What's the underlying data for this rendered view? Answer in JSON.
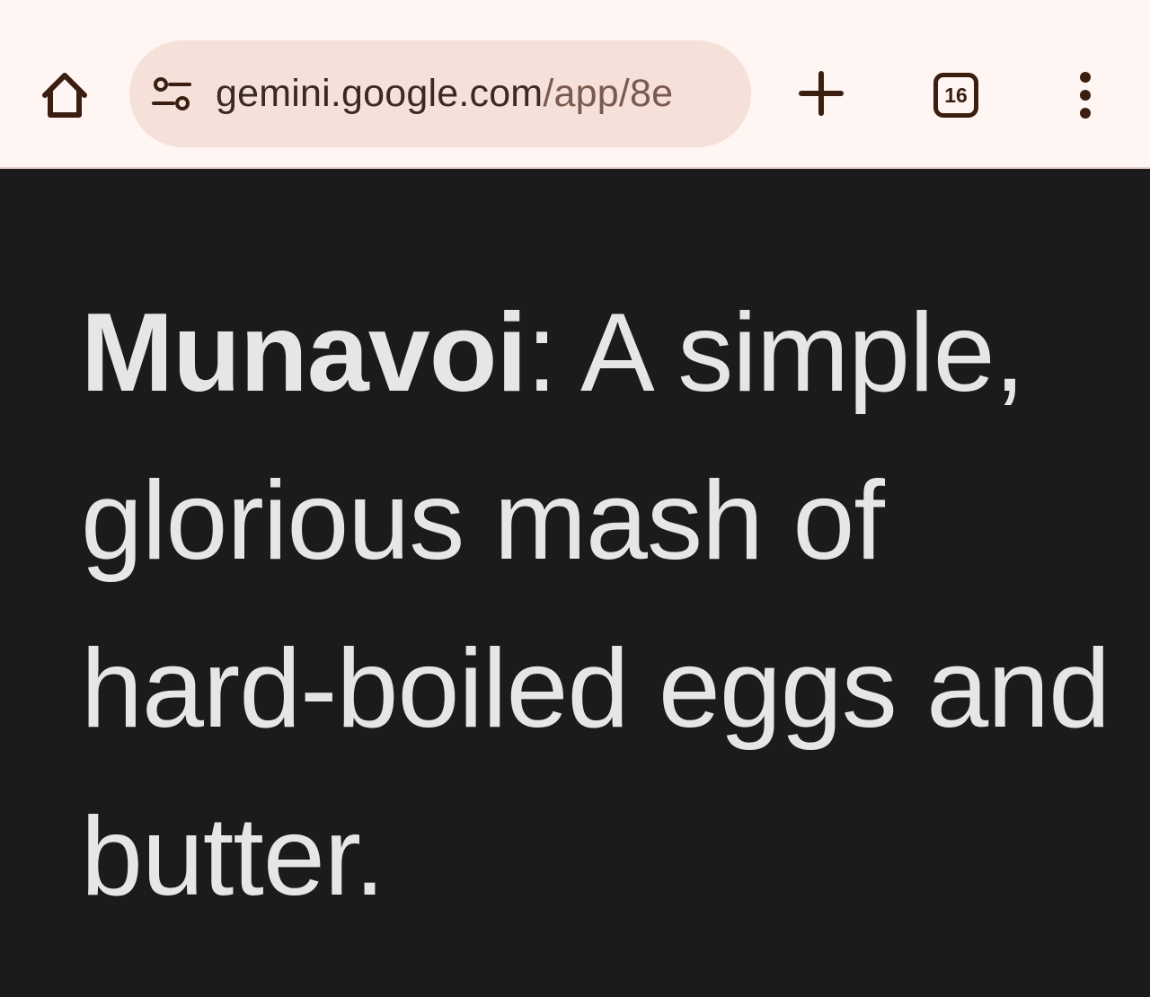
{
  "browser": {
    "url_domain": "gemini.google.com",
    "url_path": "/app/8e",
    "tab_count": "16",
    "icons": {
      "home": "home-icon",
      "site_info": "site-settings-icon",
      "new_tab": "plus-icon",
      "tabs": "tab-switcher-icon",
      "menu": "more-vert-icon"
    },
    "colors": {
      "toolbar_bg": "#fff5f2",
      "omnibox_bg": "#f5e1d9",
      "icon": "#3a1f10"
    }
  },
  "content": {
    "term": "Munavoi",
    "separator": ":",
    "definition": " A simple, glorious mash of hard-boiled eggs and butter.",
    "colors": {
      "background": "#1b1b1b",
      "text": "#e6e6e6"
    }
  }
}
